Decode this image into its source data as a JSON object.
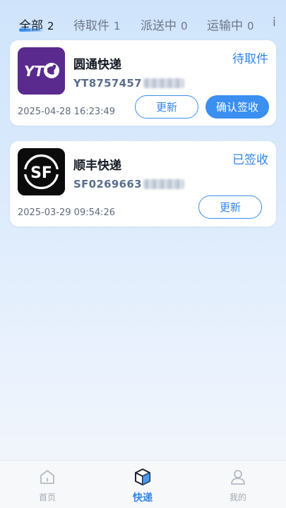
{
  "tabs": [
    {
      "label": "全部",
      "count": "2",
      "active": true
    },
    {
      "label": "待取件",
      "count": "1",
      "active": false
    },
    {
      "label": "派送中",
      "count": "0",
      "active": false
    },
    {
      "label": "运输中",
      "count": "0",
      "active": false
    },
    {
      "label": "i",
      "count": "",
      "active": false
    }
  ],
  "packages": [
    {
      "company": "圆通快递",
      "logo_icon": "yto-logo-icon",
      "logo_color": "#5a2a8e",
      "logo_text": "YT",
      "tracking_visible": "YT8757457",
      "tracking_masked": true,
      "status": "待取件",
      "datetime": "2025-04-28 16:23:49",
      "buttons": {
        "update": "更新",
        "confirm": "确认签收"
      }
    },
    {
      "company": "顺丰快递",
      "logo_icon": "sf-logo-icon",
      "logo_color": "#0b0b0b",
      "logo_text": "SF",
      "tracking_visible": "SF0269663",
      "tracking_masked": true,
      "status": "已签收",
      "datetime": "2025-03-29 09:54:26",
      "buttons": {
        "update": "更新"
      }
    }
  ],
  "nav": [
    {
      "label": "首页",
      "icon": "home-icon",
      "active": false
    },
    {
      "label": "快递",
      "icon": "package-box-icon",
      "active": true
    },
    {
      "label": "我的",
      "icon": "user-icon",
      "active": false
    }
  ],
  "colors": {
    "accent": "#2f86e8",
    "accent_button": "#3a8ff0",
    "text_primary": "#141a24",
    "text_secondary": "#5f6a7c",
    "tracking_text": "#5a6e8c"
  }
}
